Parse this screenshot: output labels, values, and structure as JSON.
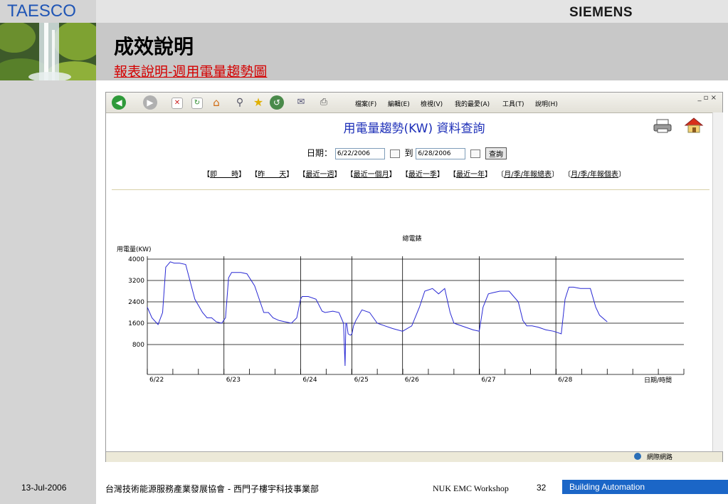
{
  "slide": {
    "brand_left": "TAESCO",
    "brand_right": "SIEMENS",
    "title": "成效說明",
    "subtitle": "報表說明-週用電量趨勢圖"
  },
  "browser": {
    "menu": [
      "檔案(F)",
      "編輯(E)",
      "檢視(V)",
      "我的最愛(A)",
      "工具(T)",
      "說明(H)"
    ],
    "window_controls": "_ ▫ ×",
    "status": "網際網路",
    "icons": [
      "back-icon",
      "forward-icon",
      "stop-icon",
      "refresh-icon",
      "home-icon",
      "search-icon",
      "favorites-icon",
      "history-icon",
      "mail-icon",
      "print-icon"
    ]
  },
  "query": {
    "title": "用電量趨勢(KW) 資料查詢",
    "date_label": "日期：",
    "start_date": "6/22/2006",
    "to_label": "到",
    "end_date": "6/28/2006",
    "button": "查詢",
    "links": [
      "即　　時",
      "昨　　天",
      "最近一週",
      "最近一個月",
      "最近一季",
      "最近一年",
      "月/季/年報總表",
      "月/季/年報個表"
    ]
  },
  "chart_data": {
    "type": "line",
    "title": "總電錶",
    "ylabel": "用電量(KW)",
    "xlabel": "日期/時間",
    "ylim": [
      0,
      4000
    ],
    "yticks": [
      800,
      1600,
      2400,
      3200,
      4000
    ],
    "xlim": [
      0,
      7
    ],
    "xticks": [
      {
        "x": 0,
        "label": "6/22"
      },
      {
        "x": 1,
        "label": "6/23"
      },
      {
        "x": 2,
        "label": "6/24"
      },
      {
        "x": 2.67,
        "label": "6/25"
      },
      {
        "x": 3.33,
        "label": "6/26"
      },
      {
        "x": 4.33,
        "label": "6/27"
      },
      {
        "x": 5.33,
        "label": "6/28"
      }
    ],
    "vlines": [
      1,
      2,
      2.67,
      3.33,
      4.33,
      5.33
    ],
    "grid": true,
    "series": [
      {
        "color": "#2a2ad4",
        "x": [
          0,
          0.06,
          0.14,
          0.2,
          0.24,
          0.3,
          0.35,
          0.42,
          0.5,
          0.62,
          0.72,
          0.78,
          0.84,
          0.9,
          0.97,
          1.02,
          1.06,
          1.1,
          1.16,
          1.22,
          1.3,
          1.4,
          1.52,
          1.58,
          1.64,
          1.72,
          1.8,
          1.88,
          1.95,
          2.0,
          2.02,
          2.1,
          2.2,
          2.28,
          2.32,
          2.42,
          2.5,
          2.56,
          2.58,
          2.59,
          2.6,
          2.62,
          2.65,
          2.67,
          2.69,
          2.72,
          2.8,
          2.9,
          3.0,
          3.1,
          3.2,
          3.33,
          3.45,
          3.55,
          3.62,
          3.72,
          3.8,
          3.88,
          3.95,
          4.0,
          4.05,
          4.15,
          4.25,
          4.33,
          4.38,
          4.45,
          4.52,
          4.6,
          4.72,
          4.84,
          4.9,
          4.95,
          5.02,
          5.1,
          5.2,
          5.3,
          5.4,
          5.45,
          5.5,
          5.56,
          5.65,
          5.78,
          5.85,
          5.9,
          6.0
        ],
        "y": [
          2200,
          1800,
          1550,
          2000,
          3700,
          3900,
          3850,
          3850,
          3800,
          2500,
          2000,
          1800,
          1800,
          1650,
          1600,
          1800,
          3300,
          3500,
          3500,
          3500,
          3450,
          3000,
          2000,
          2000,
          1800,
          1700,
          1650,
          1600,
          1800,
          2500,
          2600,
          2600,
          2500,
          2050,
          2000,
          2050,
          2000,
          1600,
          0,
          1600,
          1600,
          1200,
          1150,
          1200,
          1500,
          1700,
          2100,
          2000,
          1600,
          1500,
          1400,
          1300,
          1500,
          2200,
          2800,
          2900,
          2700,
          2900,
          2000,
          1600,
          1550,
          1450,
          1350,
          1300,
          2200,
          2700,
          2750,
          2800,
          2800,
          2400,
          1700,
          1500,
          1500,
          1450,
          1350,
          1300,
          1200,
          2500,
          2950,
          2950,
          2900,
          2900,
          2200,
          1900,
          1650
        ]
      }
    ]
  }
}
